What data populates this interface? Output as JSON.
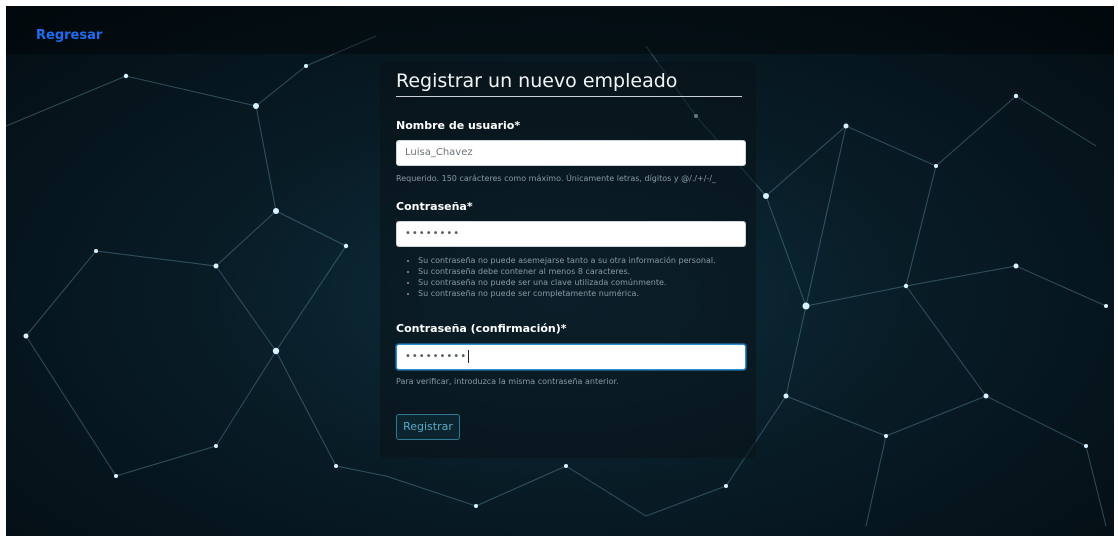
{
  "nav": {
    "back_label": "Regresar"
  },
  "form": {
    "title": "Registrar un nuevo empleado",
    "username": {
      "label": "Nombre de usuario*",
      "value": "Luisa_Chavez",
      "help": "Requerido. 150 carácteres como máximo. Únicamente letras, dígitos y @/./+/-/_"
    },
    "password": {
      "label": "Contraseña*",
      "value_masked": "••••••••",
      "rules": [
        "Su contraseña no puede asemejarse tanto a su otra información personal.",
        "Su contraseña debe contener al menos 8 caracteres.",
        "Su contraseña no puede ser una clave utilizada comúnmente.",
        "Su contraseña no puede ser completamente numérica."
      ]
    },
    "password_confirm": {
      "label": "Contraseña (confirmación)*",
      "value_masked": "•••••••••",
      "help": "Para verificar, introduzca la misma contraseña anterior."
    },
    "submit_label": "Registrar"
  },
  "colors": {
    "link": "#1e6cf0",
    "background": "#081c26",
    "button_text": "#58a9c6",
    "button_border": "#2f7a93"
  }
}
